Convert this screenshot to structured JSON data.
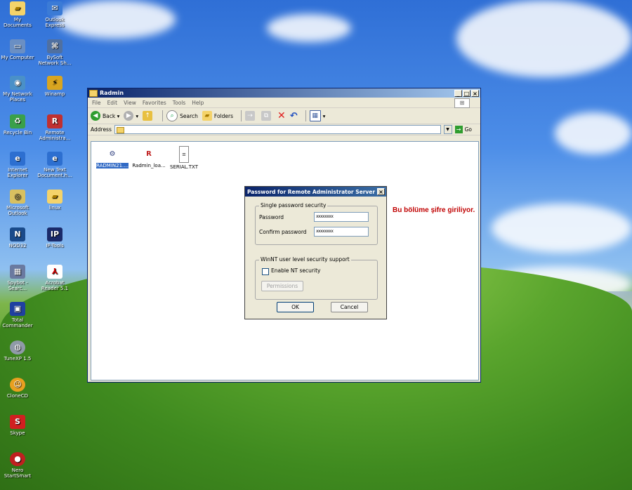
{
  "desktop": {
    "icons": [
      {
        "label": "My Documents"
      },
      {
        "label": "Outlook Express"
      },
      {
        "label": "My Computer"
      },
      {
        "label": "BySoft Network Sh..."
      },
      {
        "label": "My Network Places"
      },
      {
        "label": "Winamp"
      },
      {
        "label": "Recycle Bin"
      },
      {
        "label": "Remote Administra..."
      },
      {
        "label": "Internet Explorer"
      },
      {
        "label": "New Text Document.h..."
      },
      {
        "label": "Microsoft Outlook"
      },
      {
        "label": "linux"
      },
      {
        "label": "NOD32"
      },
      {
        "label": "IP-Tools"
      },
      {
        "label": "Spybot - Searc..."
      },
      {
        "label": "Acrobat Reader 5.1"
      },
      {
        "label": "Total Commander"
      },
      {
        "label": "TuneXP 1.5"
      },
      {
        "label": "CloneCD"
      },
      {
        "label": "Skype"
      },
      {
        "label": "Nero StartSmart"
      }
    ]
  },
  "explorer": {
    "title": "Radmin",
    "menu": [
      "File",
      "Edit",
      "View",
      "Favorites",
      "Tools",
      "Help"
    ],
    "toolbar": {
      "back": "Back",
      "search": "Search",
      "folders": "Folders"
    },
    "address_label": "Address",
    "go_label": "Go",
    "files": [
      {
        "name": "RADMIN21....",
        "icon": "installer-icon"
      },
      {
        "name": "Radmin_loa...",
        "icon": "radmin-icon"
      },
      {
        "name": "SERIAL.TXT",
        "icon": "text-file-icon"
      }
    ]
  },
  "dialog": {
    "title": "Password for Remote Administrator Server",
    "group1": "Single password security",
    "password_label": "Password",
    "password_value": "xxxxxxxx",
    "confirm_label": "Confirm password",
    "confirm_value": "xxxxxxxx",
    "group2": "WinNT user level security support",
    "enable_nt": "Enable NT security",
    "permissions": "Permissions",
    "ok": "OK",
    "cancel": "Cancel"
  },
  "annotation": "Bu bölüme şifre giriliyor."
}
